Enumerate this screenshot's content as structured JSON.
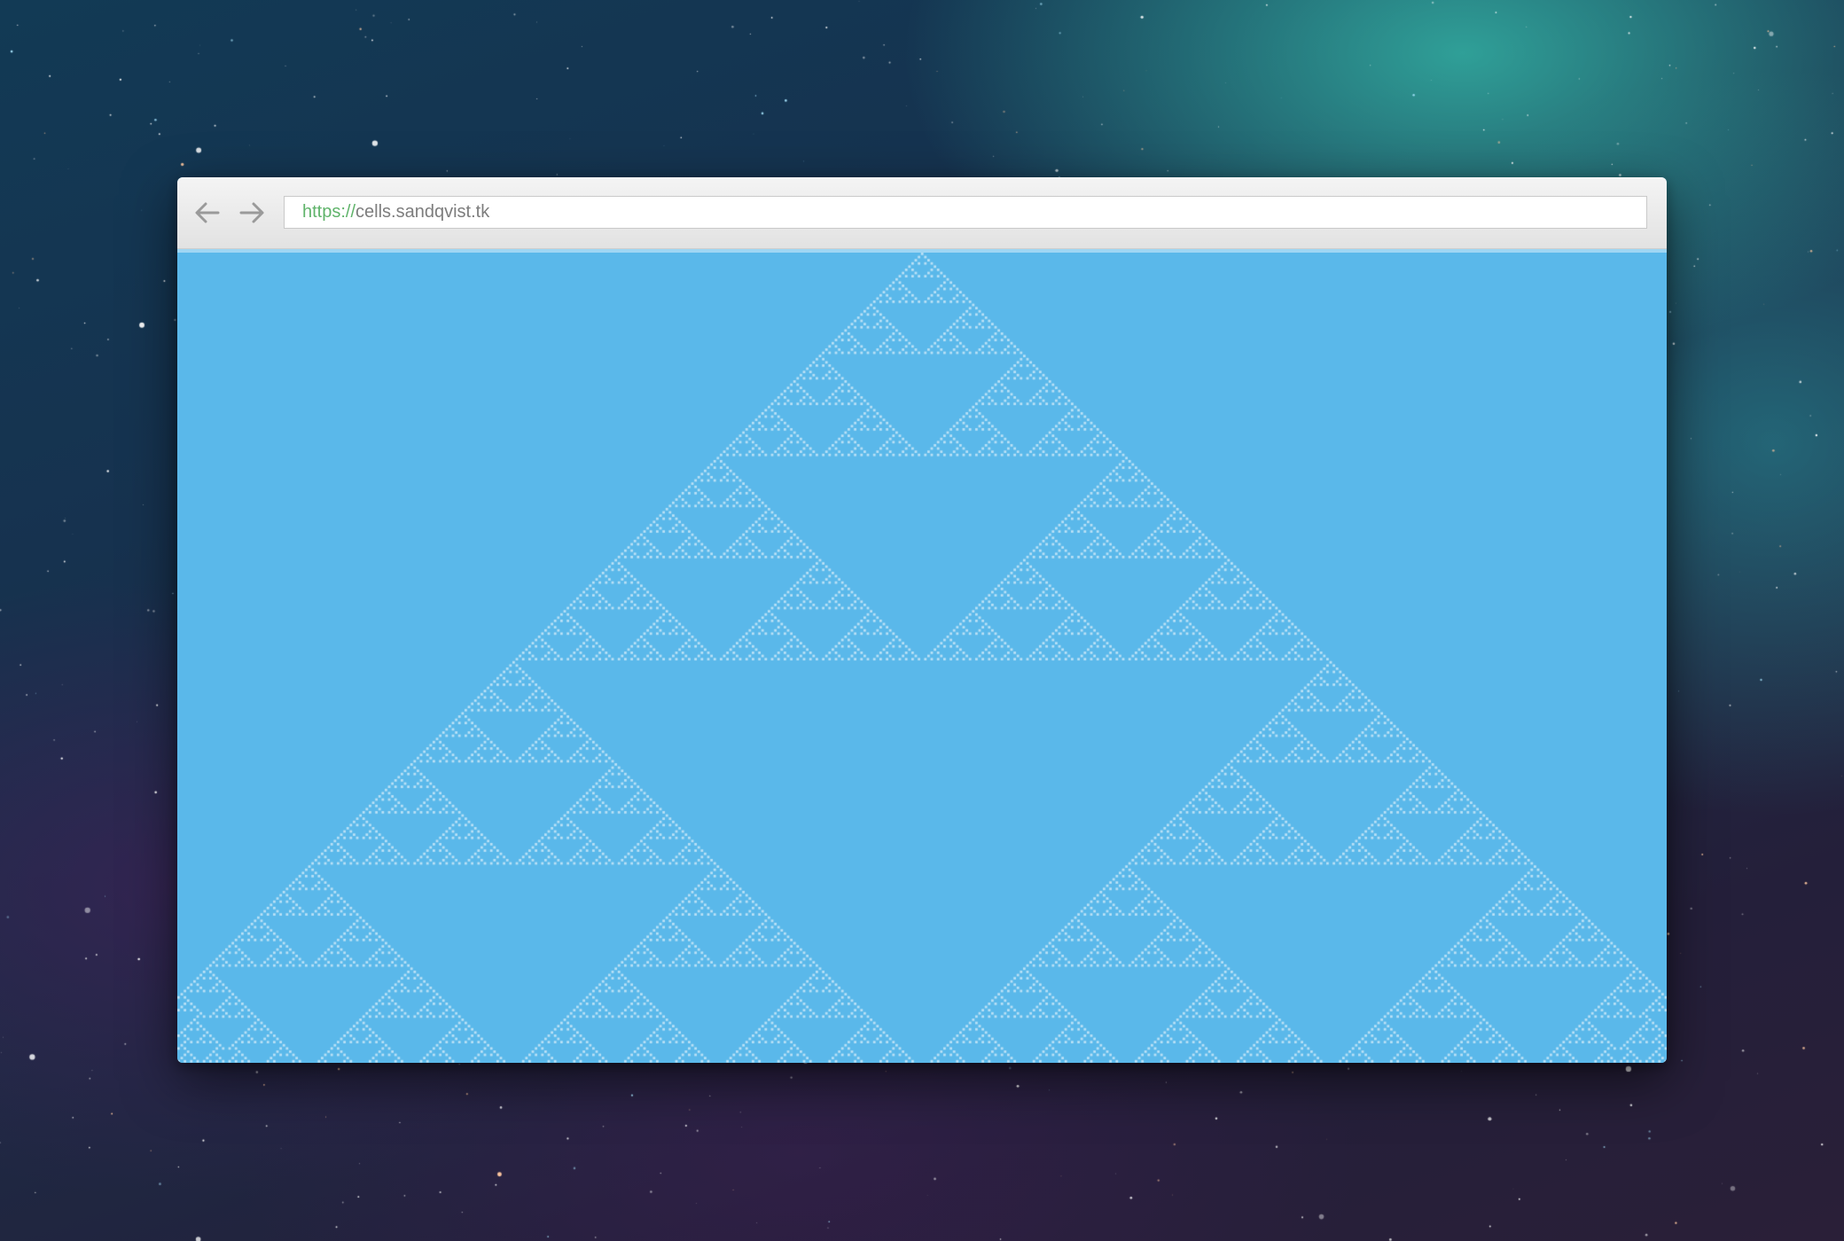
{
  "browser": {
    "nav": {
      "back_icon": "arrow-left-icon",
      "forward_icon": "arrow-right-icon"
    },
    "address_bar": {
      "scheme": "https://",
      "host": "cells.sandqvist.tk"
    }
  },
  "page": {
    "automaton": "Rule 90 (Sierpinski triangle) cellular automaton",
    "background_color": "#5ab8ea",
    "cell_color": "#b9e0f6"
  },
  "colors": {
    "toolbar": "#e9e9e9",
    "url_scheme": "#5fb36a",
    "url_host": "#7d7d7d",
    "icon": "#9a9a9a"
  }
}
